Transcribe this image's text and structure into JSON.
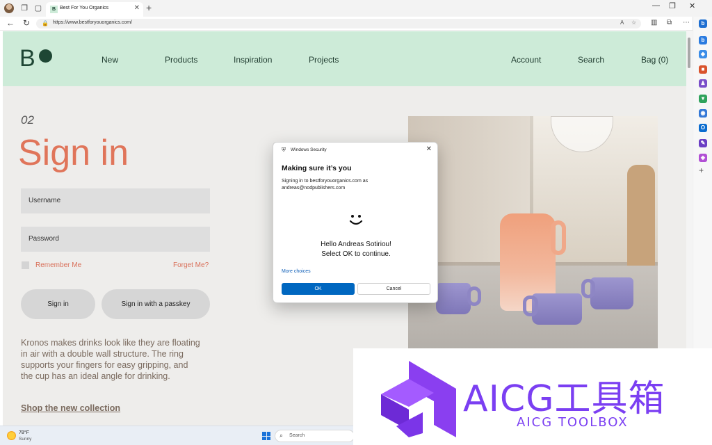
{
  "browser": {
    "tab_title": "Best For You Organics",
    "tab_favicon_text": "B",
    "url": "https://www.bestforyouorganics.com/"
  },
  "site": {
    "logo_letter": "B",
    "nav": [
      "New",
      "Products",
      "Inspiration",
      "Projects"
    ],
    "nav_right": [
      "Account",
      "Search",
      "Bag (0)"
    ],
    "step": "02",
    "heading": "Sign in",
    "username_label": "Username",
    "password_label": "Password",
    "remember_label": "Remember Me",
    "forget_label": "Forget Me?",
    "signin_button": "Sign in",
    "passkey_button": "Sign in with a passkey",
    "description": "Kronos makes drinks look like they are floating in air with a double wall structure. The ring supports your fingers for easy gripping, and the cup has an ideal angle for drinking.",
    "shop_link": "Shop the new collection",
    "colors": {
      "header": "#cdebd8",
      "accent": "#e0755a",
      "logo": "#1e4634"
    }
  },
  "dialog": {
    "app_name": "Windows Security",
    "title": "Making sure it’s you",
    "line1": "Signing in to bestforyouorganics.com as",
    "line2": "andreas@nodpublishers.com",
    "face": "⌣",
    "hello": "Hello Andreas Sotiriou!",
    "instruction": "Select OK to continue.",
    "more_choices": "More choices",
    "ok": "OK",
    "cancel": "Cancel"
  },
  "taskbar": {
    "temp": "78°F",
    "condition": "Sunny",
    "search": "Search"
  },
  "watermark": {
    "title": "AICG工具箱",
    "subtitle": "AICG TOOLBOX"
  }
}
